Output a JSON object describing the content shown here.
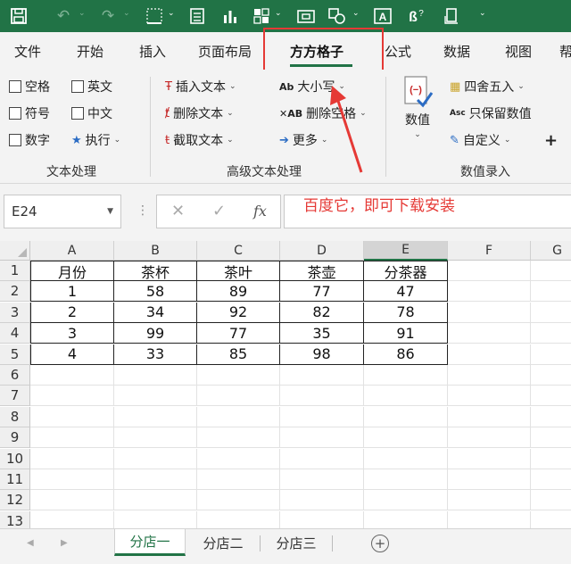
{
  "qat": {
    "icons": [
      "save-icon",
      "undo-icon",
      "redo-icon",
      "border-icon",
      "form-icon",
      "chart-icon",
      "paste-icon",
      "camera-icon",
      "shapes-icon",
      "textbox-icon",
      "help-icon",
      "ribbon-icon",
      "more-icon"
    ]
  },
  "tabs": [
    "文件",
    "开始",
    "插入",
    "页面布局",
    "方方格子",
    "公式",
    "数据",
    "视图",
    "帮"
  ],
  "ribbon": {
    "text_group": {
      "checkboxes": [
        "空格",
        "英文",
        "符号",
        "中文",
        "数字"
      ],
      "execute_label": "执行",
      "label": "文本处理"
    },
    "advanced_group": {
      "insert_text": "插入文本",
      "delete_text": "删除文本",
      "extract_text": "截取文本",
      "case_label": "大小写",
      "delete_space": "删除空格",
      "more_label": "更多",
      "label": "高级文本处理"
    },
    "numeric_group": {
      "value_label": "数值",
      "round_label": "四舍五入",
      "keep_value": "只保留数值",
      "custom_label": "自定义",
      "label": "数值录入"
    }
  },
  "formula_bar": {
    "name_box": "E24",
    "cancel_symbol": "✕",
    "confirm_symbol": "✓",
    "fx_symbol": "fx",
    "annotation": "百度它，即可下载安装"
  },
  "grid": {
    "columns": [
      "A",
      "B",
      "C",
      "D",
      "E",
      "F",
      "G"
    ],
    "rows": [
      "1",
      "2",
      "3",
      "4",
      "5",
      "6",
      "7",
      "8",
      "9",
      "10",
      "11",
      "12",
      "13"
    ],
    "headers": [
      "月份",
      "茶杯",
      "茶叶",
      "茶壶",
      "分茶器"
    ],
    "data": [
      [
        "1",
        "58",
        "89",
        "77",
        "47"
      ],
      [
        "2",
        "34",
        "92",
        "82",
        "78"
      ],
      [
        "3",
        "99",
        "77",
        "35",
        "91"
      ],
      [
        "4",
        "33",
        "85",
        "98",
        "86"
      ]
    ]
  },
  "sheets": [
    "分店一",
    "分店二",
    "分店三"
  ],
  "colors": {
    "accent": "#217346",
    "highlight": "#e53935"
  }
}
